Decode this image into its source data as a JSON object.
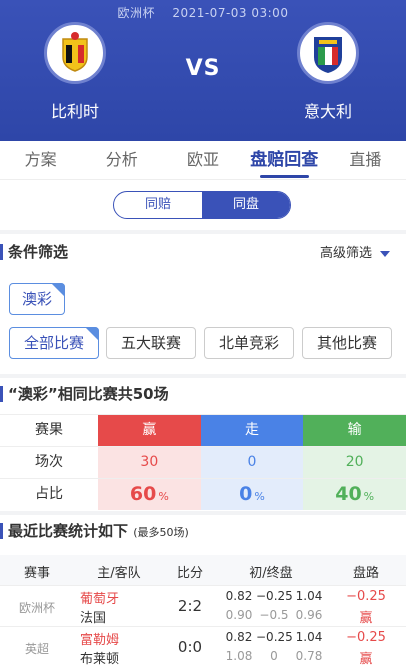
{
  "header": {
    "competition": "欧洲杯",
    "datetime": "2021-07-03 03:00",
    "vs": "VS",
    "home": {
      "name": "比利时"
    },
    "away": {
      "name": "意大利"
    }
  },
  "tabs": [
    {
      "label": "方案"
    },
    {
      "label": "分析"
    },
    {
      "label": "欧亚"
    },
    {
      "label": "盘赔回查"
    },
    {
      "label": "直播"
    }
  ],
  "segment": {
    "options": [
      {
        "label": "同赔"
      },
      {
        "label": "同盘"
      }
    ]
  },
  "filter": {
    "title": "条件筛选",
    "advanced": "高级筛选",
    "company": "澳彩",
    "chips": [
      {
        "label": "全部比赛"
      },
      {
        "label": "五大联赛"
      },
      {
        "label": "北单竞彩"
      },
      {
        "label": "其他比赛"
      }
    ]
  },
  "stats": {
    "title": "“澳彩”相同比赛共50场",
    "headers": [
      "赛果",
      "赢",
      "走",
      "输"
    ],
    "count_label": "场次",
    "counts": [
      "30",
      "0",
      "20"
    ],
    "pct_label": "占比",
    "pcts": [
      "60",
      "0",
      "40"
    ],
    "pct_unit": "%"
  },
  "recent": {
    "title": "最近比赛统计如下",
    "note": "(最多50场)",
    "headers": [
      "赛事",
      "主/客队",
      "比分",
      "初/终盘",
      "盘路"
    ],
    "matches": [
      {
        "league": "欧洲杯",
        "home": "葡萄牙",
        "away": "法国",
        "score": "2:2",
        "open": [
          "0.82",
          "−0.25",
          "1.04"
        ],
        "close": [
          "0.90",
          "−0.5",
          "0.96"
        ],
        "line": "−0.25",
        "result": "赢"
      },
      {
        "league": "英超",
        "home": "富勒姆",
        "away": "布莱顿",
        "score": "0:0",
        "open": [
          "0.82",
          "−0.25",
          "1.04"
        ],
        "close": [
          "1.08",
          "0",
          "0.78"
        ],
        "line": "−0.25",
        "result": "赢"
      }
    ]
  },
  "colors": {
    "primary": "#3a52b8",
    "win": "#e64a4a",
    "draw": "#4a82e6",
    "lose": "#51b05a"
  }
}
